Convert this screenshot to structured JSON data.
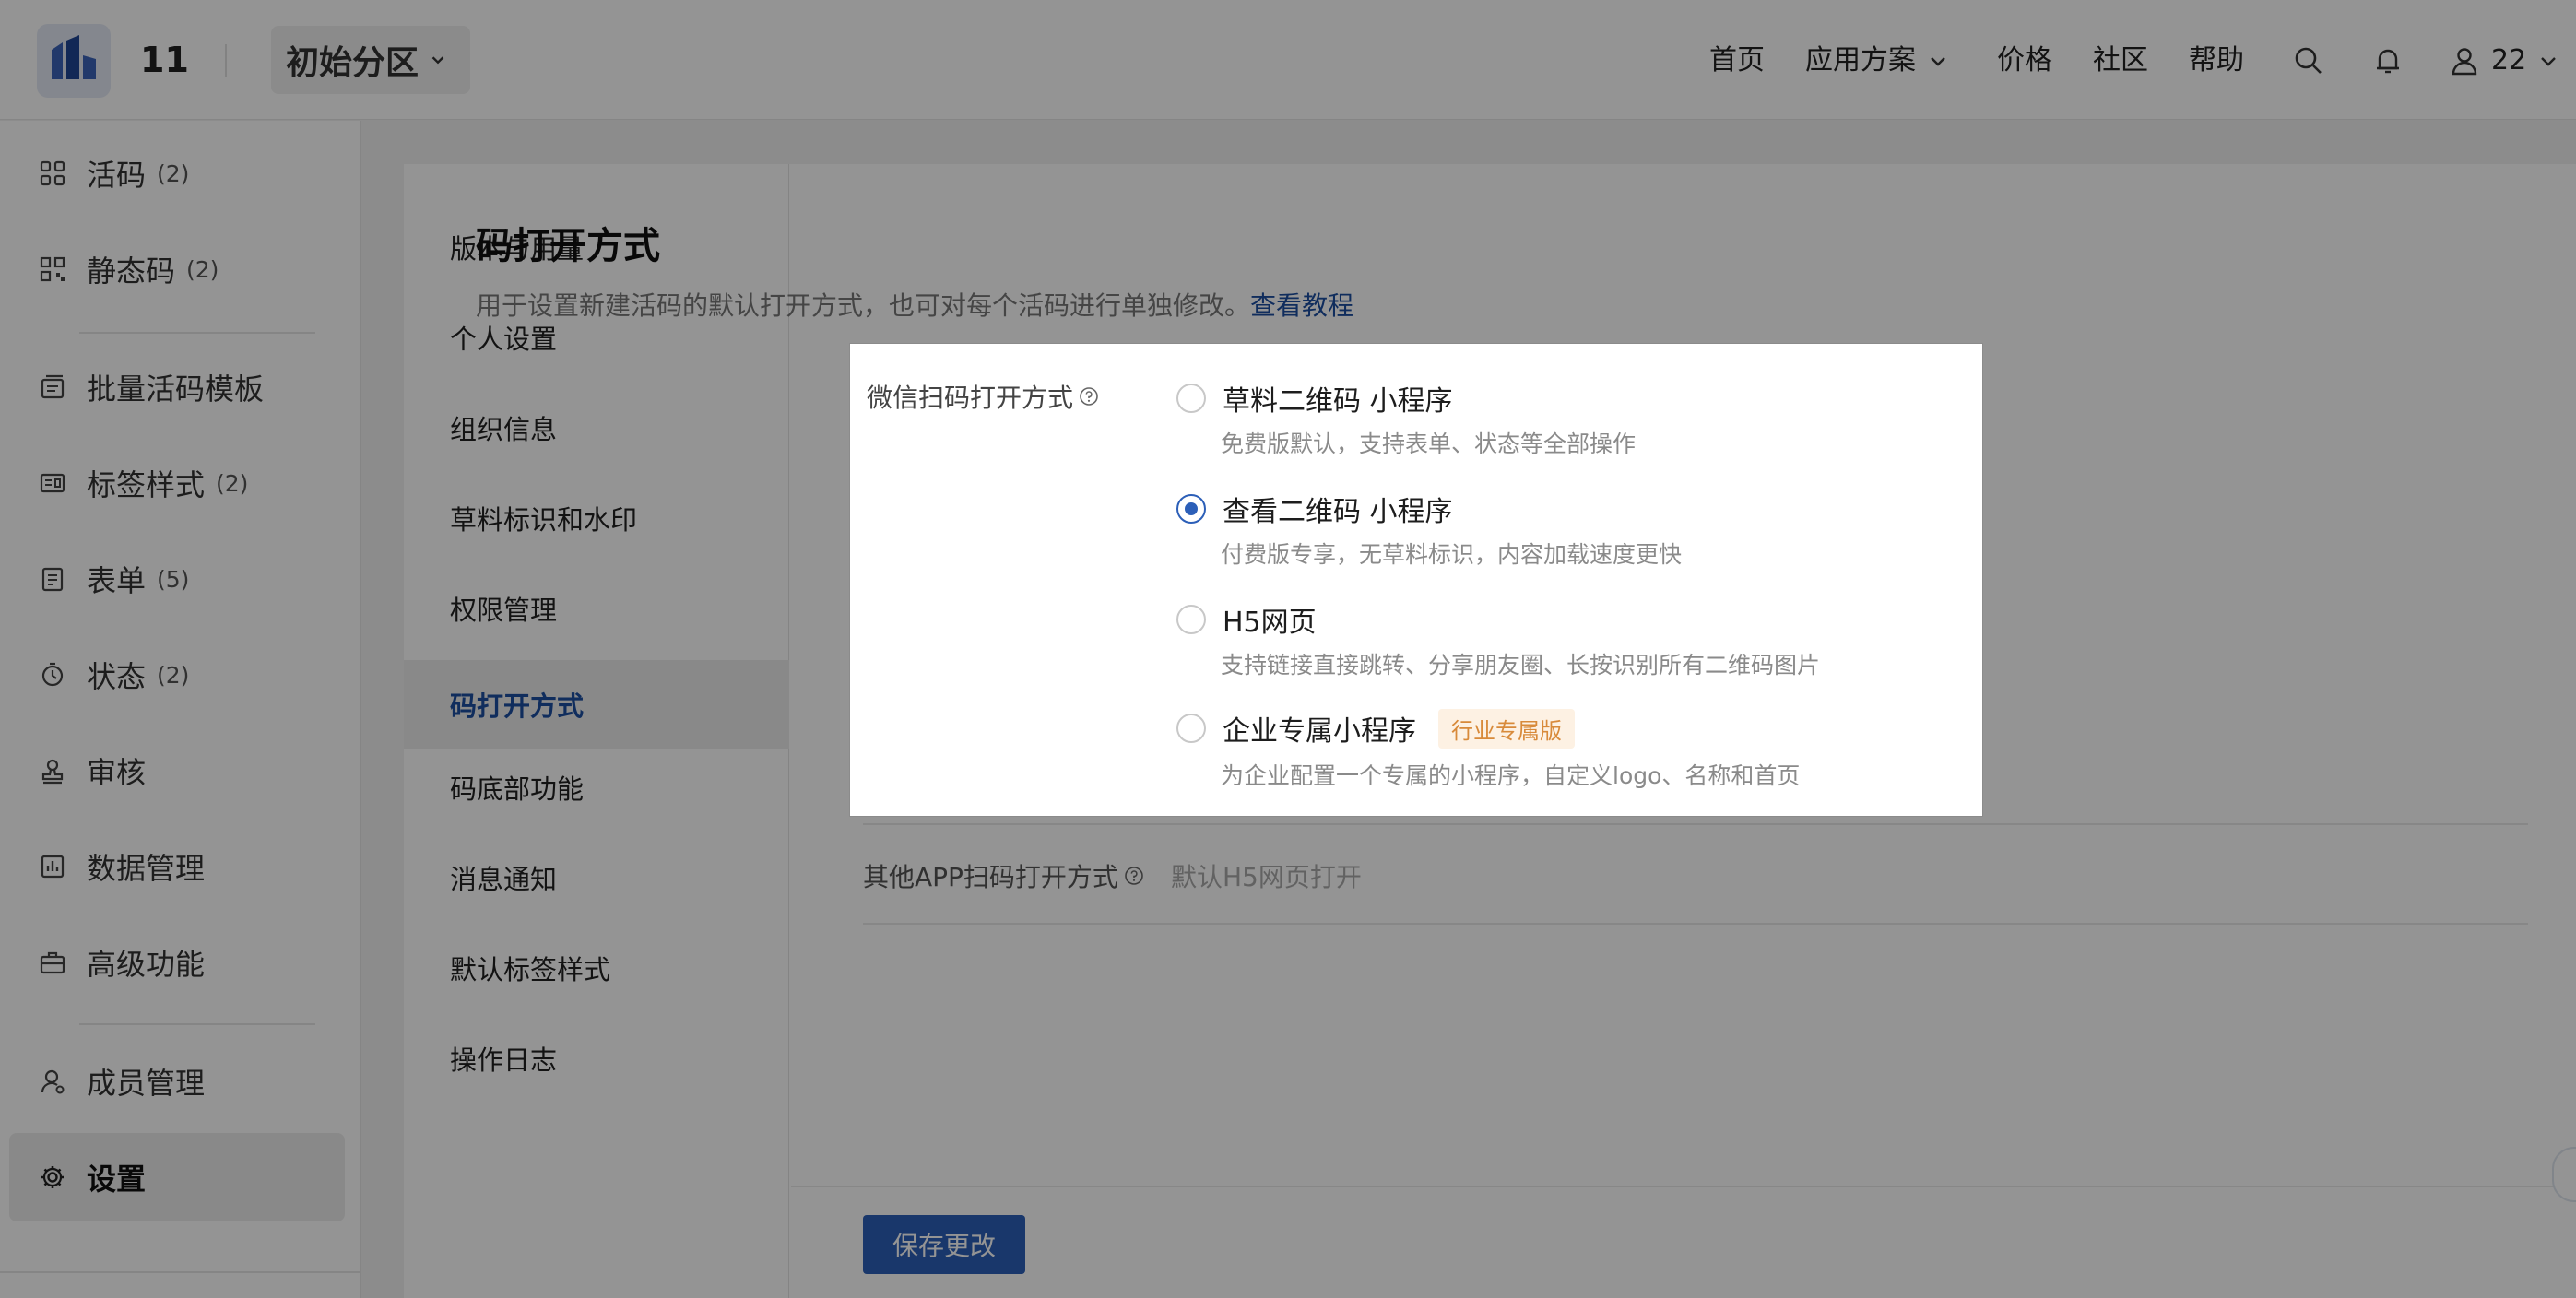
{
  "header": {
    "org_number": "11",
    "partition_label": "初始分区",
    "nav": {
      "home": "首页",
      "solutions": "应用方案",
      "pricing": "价格",
      "community": "社区",
      "help": "帮助",
      "user_number": "22"
    }
  },
  "sidebar": {
    "items": [
      {
        "label": "活码",
        "count": "(2)",
        "icon": "qrcode-icon"
      },
      {
        "label": "静态码",
        "count": "(2)",
        "icon": "static-qrcode-icon"
      },
      {
        "label": "批量活码模板",
        "count": "",
        "icon": "template-icon"
      },
      {
        "label": "标签样式",
        "count": "(2)",
        "icon": "label-icon"
      },
      {
        "label": "表单",
        "count": "(5)",
        "icon": "form-icon"
      },
      {
        "label": "状态",
        "count": "(2)",
        "icon": "status-icon"
      },
      {
        "label": "审核",
        "count": "",
        "icon": "stamp-icon"
      },
      {
        "label": "数据管理",
        "count": "",
        "icon": "chart-icon"
      },
      {
        "label": "高级功能",
        "count": "",
        "icon": "briefcase-icon"
      },
      {
        "label": "成员管理",
        "count": "",
        "icon": "member-icon"
      },
      {
        "label": "设置",
        "count": "",
        "icon": "gear-icon"
      }
    ]
  },
  "submenu": {
    "items": [
      "版本与用量",
      "个人设置",
      "组织信息",
      "草料标识和水印",
      "权限管理",
      "码打开方式",
      "码底部功能",
      "消息通知",
      "默认标签样式",
      "操作日志"
    ],
    "active": "码打开方式"
  },
  "content": {
    "title": "码打开方式",
    "description": "用于设置新建活码的默认打开方式，也可对每个活码进行单独修改。",
    "tutorial_link": "查看教程",
    "wechat_label": "微信扫码打开方式",
    "options": [
      {
        "title": "草料二维码 小程序",
        "desc": "免费版默认，支持表单、状态等全部操作",
        "checked": false,
        "tag": ""
      },
      {
        "title": "查看二维码 小程序",
        "desc": "付费版专享，无草料标识，内容加载速度更快",
        "checked": true,
        "tag": ""
      },
      {
        "title": "H5网页",
        "desc": "支持链接直接跳转、分享朋友圈、长按识别所有二维码图片",
        "checked": false,
        "tag": ""
      },
      {
        "title": "企业专属小程序",
        "desc": "为企业配置一个专属的小程序，自定义logo、名称和首页",
        "checked": false,
        "tag": "行业专属版"
      }
    ],
    "other_app_label": "其他APP扫码打开方式",
    "other_app_value": "默认H5网页打开",
    "save_button": "保存更改"
  },
  "colors": {
    "accent": "#2c5fb8",
    "link": "#1d4ea0",
    "tag_bg": "#fdf1e3",
    "tag_text": "#d88a3a"
  }
}
